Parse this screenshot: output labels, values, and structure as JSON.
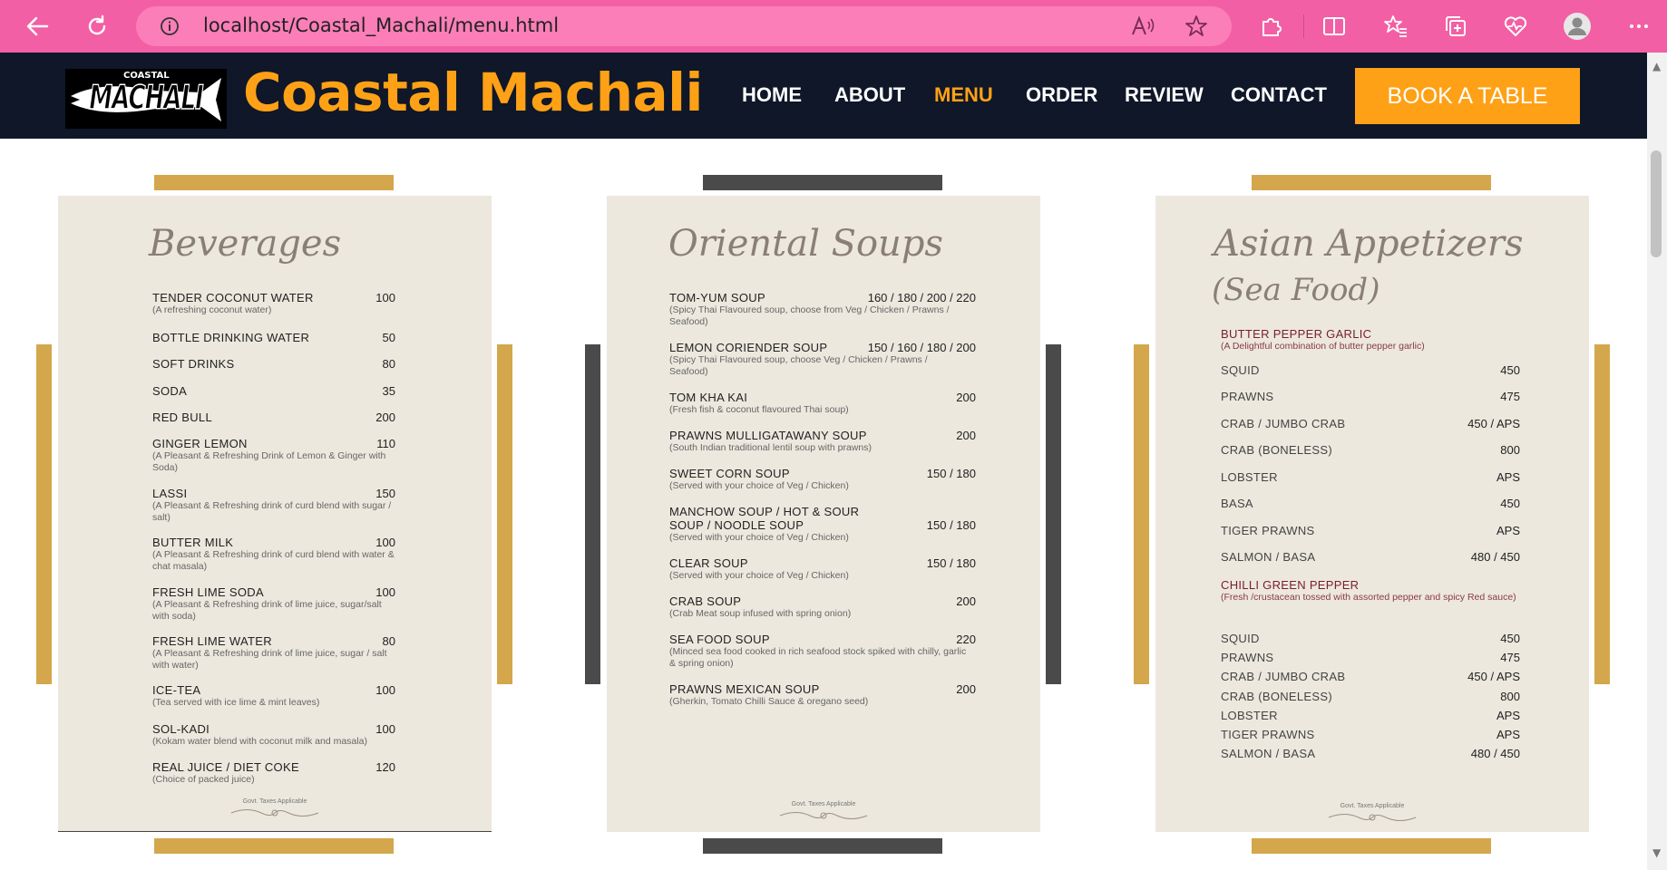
{
  "browser": {
    "url": "localhost/Coastal_Machali/menu.html"
  },
  "site": {
    "logo_small": "COASTAL",
    "logo_main": "MACHALI",
    "brand": "Coastal Machali",
    "nav": [
      "HOME",
      "ABOUT",
      "MENU",
      "ORDER",
      "REVIEW",
      "CONTACT"
    ],
    "active_nav": "MENU",
    "book_label": "BOOK A TABLE",
    "accent_color": "#fea116",
    "header_bg": "#0f1729"
  },
  "menus": [
    {
      "title": "Beverages",
      "footer": "Govt. Taxes Applicable",
      "items": [
        {
          "name": "TENDER COCONUT WATER",
          "price": "100",
          "desc": "(A refreshing coconut water)"
        },
        {
          "name": "BOTTLE DRINKING WATER",
          "price": "50",
          "desc": ""
        },
        {
          "name": "SOFT DRINKS",
          "price": "80",
          "desc": ""
        },
        {
          "name": "SODA",
          "price": "35",
          "desc": ""
        },
        {
          "name": "RED BULL",
          "price": "200",
          "desc": ""
        },
        {
          "name": "GINGER LEMON",
          "price": "110",
          "desc": "(A Pleasant & Refreshing Drink of Lemon & Ginger with Soda)"
        },
        {
          "name": "LASSI",
          "price": "150",
          "desc": "(A Pleasant & Refreshing drink of curd blend with sugar / salt)"
        },
        {
          "name": "BUTTER MILK",
          "price": "100",
          "desc": "(A Pleasant & Refreshing drink of curd blend with water & chat masala)"
        },
        {
          "name": "FRESH LIME SODA",
          "price": "100",
          "desc": "(A Pleasant & Refreshing drink of lime juice, sugar/salt with soda)"
        },
        {
          "name": "FRESH LIME WATER",
          "price": "80",
          "desc": "(A Pleasant & Refreshing drink of lime juice, sugar / salt with water)"
        },
        {
          "name": "ICE-TEA",
          "price": "100",
          "desc": "(Tea served with ice lime & mint leaves)"
        },
        {
          "name": "SOL-KADI",
          "price": "100",
          "desc": "(Kokam water blend with coconut milk and masala)"
        },
        {
          "name": "REAL JUICE / DIET COKE",
          "price": "120",
          "desc": "(Choice of packed juice)"
        }
      ]
    },
    {
      "title": "Oriental Soups",
      "footer": "Govt. Taxes Applicable",
      "items": [
        {
          "name": "TOM-YUM SOUP",
          "price": "160 / 180 / 200 / 220",
          "desc": "(Spicy Thai Flavoured soup, choose from Veg / Chicken / Prawns / Seafood)"
        },
        {
          "name": "LEMON CORIENDER SOUP",
          "price": "150 / 160 / 180 / 200",
          "desc": "(Spicy Thai Flavoured soup, choose Veg / Chicken / Prawns / Seafood)"
        },
        {
          "name": "TOM KHA KAI",
          "price": "200",
          "desc": "(Fresh fish & coconut flavoured Thai soup)"
        },
        {
          "name": "PRAWNS MULLIGATAWANY SOUP",
          "price": "200",
          "desc": "(South Indian traditional lentil soup with prawns)"
        },
        {
          "name": "SWEET CORN SOUP",
          "price": "150 / 180",
          "desc": "(Served with your choice of Veg / Chicken)"
        },
        {
          "name": "MANCHOW SOUP / HOT & SOUR SOUP / NOODLE SOUP",
          "price": "150 / 180",
          "desc": "(Served with your choice of Veg / Chicken)"
        },
        {
          "name": "CLEAR SOUP",
          "price": "150 / 180",
          "desc": "(Served with your choice of Veg / Chicken)"
        },
        {
          "name": "CRAB SOUP",
          "price": "200",
          "desc": "(Crab Meat soup infused with spring onion)"
        },
        {
          "name": "SEA FOOD SOUP",
          "price": "220",
          "desc": "(Minced sea food cooked in rich seafood stock spiked with chilly, garlic & spring onion)"
        },
        {
          "name": "PRAWNS MEXICAN SOUP",
          "price": "200",
          "desc": "(Gherkin, Tomato Chilli Sauce & oregano seed)"
        }
      ]
    },
    {
      "title": "Asian Appetizers",
      "subtitle": "(Sea Food)",
      "footer": "Govt. Taxes Applicable",
      "sections": [
        {
          "heading": "BUTTER PEPPER GARLIC",
          "desc": "(A Delightful combination of butter pepper garlic)",
          "items": [
            {
              "name": "SQUID",
              "price": "450"
            },
            {
              "name": "PRAWNS",
              "price": "475"
            },
            {
              "name": "CRAB / JUMBO CRAB",
              "price": "450 / APS"
            },
            {
              "name": "CRAB (BONELESS)",
              "price": "800"
            },
            {
              "name": "LOBSTER",
              "price": "APS"
            },
            {
              "name": "BASA",
              "price": "450"
            },
            {
              "name": "TIGER PRAWNS",
              "price": "APS"
            },
            {
              "name": "SALMON / BASA",
              "price": "480 / 450"
            }
          ]
        },
        {
          "heading": "CHILLI GREEN PEPPER",
          "desc": "(Fresh /crustacean tossed with assorted pepper and spicy Red sauce)",
          "items": [
            {
              "name": "SQUID",
              "price": "450"
            },
            {
              "name": "PRAWNS",
              "price": "475"
            },
            {
              "name": "CRAB / JUMBO CRAB",
              "price": "450 / APS"
            },
            {
              "name": "CRAB (BONELESS)",
              "price": "800"
            },
            {
              "name": "LOBSTER",
              "price": "APS"
            },
            {
              "name": "TIGER PRAWNS",
              "price": "APS"
            },
            {
              "name": "SALMON / BASA",
              "price": "480 / 450"
            }
          ]
        }
      ]
    }
  ],
  "colors": {
    "gold": "#d4a74c",
    "dark": "#4a4a4a",
    "card_bg": "#ece8de",
    "browser_pink": "#f35fa4"
  }
}
